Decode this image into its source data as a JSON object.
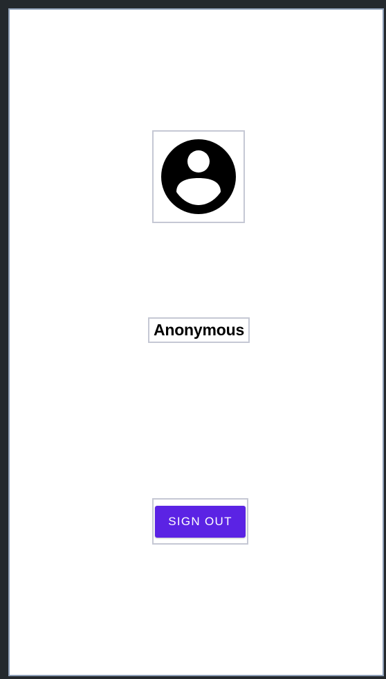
{
  "colors": {
    "background": "#ffffff",
    "outer": "#24292d",
    "frame_border": "#8fa0b8",
    "bounds_outline": "#c5c8d4",
    "button_accent": "#5b23e4",
    "button_text": "#ffffff",
    "name_text": "#000000"
  },
  "profile": {
    "avatar_icon": "account-circle-icon",
    "display_name": "Anonymous"
  },
  "actions": {
    "sign_out_label": "SIGN OUT"
  }
}
